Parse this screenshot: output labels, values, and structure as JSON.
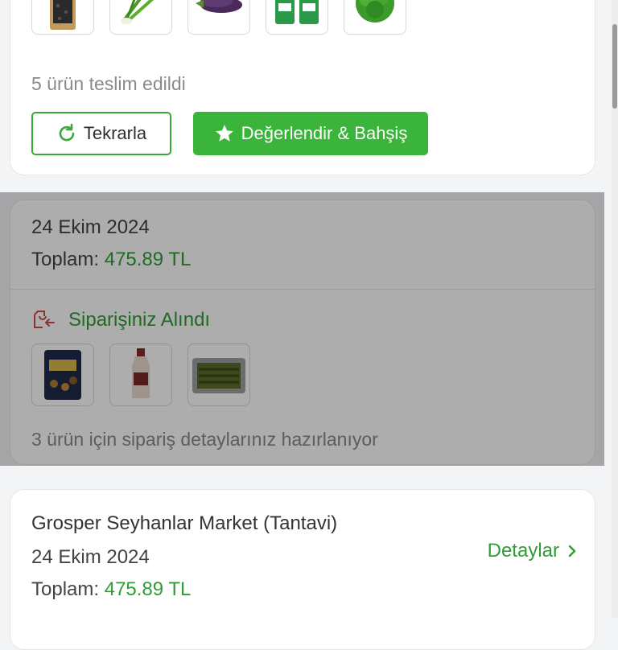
{
  "orders": [
    {
      "products": [
        "spice-jar",
        "green-onion",
        "eggplant",
        "ayran-pack",
        "lettuce"
      ],
      "summary": "5 ürün teslim edildi",
      "repeat_label": "Tekrarla",
      "rate_label": "Değerlendir & Bahşiş"
    },
    {
      "date": "24 Ekim 2024",
      "total_label": "Toplam:",
      "total_amount": "475.89 TL",
      "status": "Siparişiniz Alındı",
      "products": [
        "mixed-nuts-bag",
        "sauce-bottle",
        "stuffed-leaves-tray"
      ],
      "summary": "3 ürün için sipariş detaylarınız hazırlanıyor"
    },
    {
      "store": "Grosper Seyhanlar Market (Tantavi)",
      "date": "24 Ekim 2024",
      "total_label": "Toplam:",
      "total_amount": "475.89 TL",
      "details_label": "Detaylar"
    }
  ],
  "colors": {
    "accent": "#3bb43b",
    "accent_text": "#2f9c35",
    "muted": "#8a8a8a"
  }
}
